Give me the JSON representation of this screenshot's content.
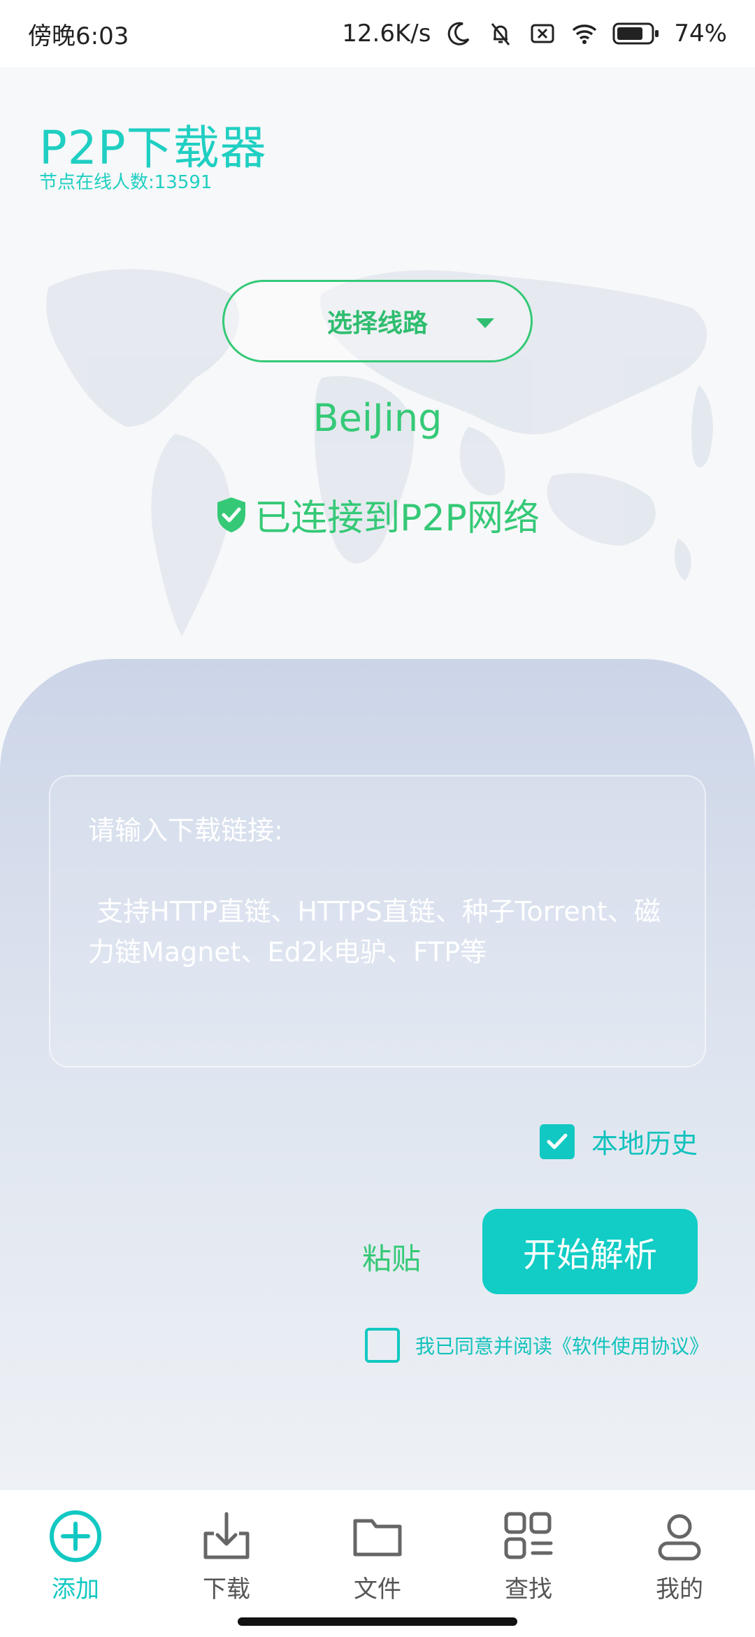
{
  "status_bar": {
    "time": "傍晚6:03",
    "net_speed": "12.6K/s",
    "battery": "74%"
  },
  "header": {
    "title": "P2P下载器",
    "online": "节点在线人数:13591"
  },
  "route": {
    "select_label": "选择线路",
    "city": "BeiJing",
    "status": "已连接到P2P网络"
  },
  "input": {
    "placeholder": "请输入下载链接:\n\n 支持HTTP直链、HTTPS直链、种子Torrent、磁力链Magnet、Ed2k电驴、FTP等"
  },
  "options": {
    "history_label": "本地历史",
    "history_checked": true,
    "paste_label": "粘贴",
    "parse_label": "开始解析",
    "agree_label": "我已同意并阅读《软件使用协议》",
    "agree_checked": false
  },
  "nav": {
    "items": [
      {
        "label": "添加",
        "icon": "add-circle-icon",
        "active": true
      },
      {
        "label": "下载",
        "icon": "download-icon",
        "active": false
      },
      {
        "label": "文件",
        "icon": "folder-icon",
        "active": false
      },
      {
        "label": "查找",
        "icon": "apps-search-icon",
        "active": false
      },
      {
        "label": "我的",
        "icon": "profile-icon",
        "active": false
      }
    ]
  },
  "colors": {
    "accent": "#12c8c2",
    "green": "#35c977"
  }
}
